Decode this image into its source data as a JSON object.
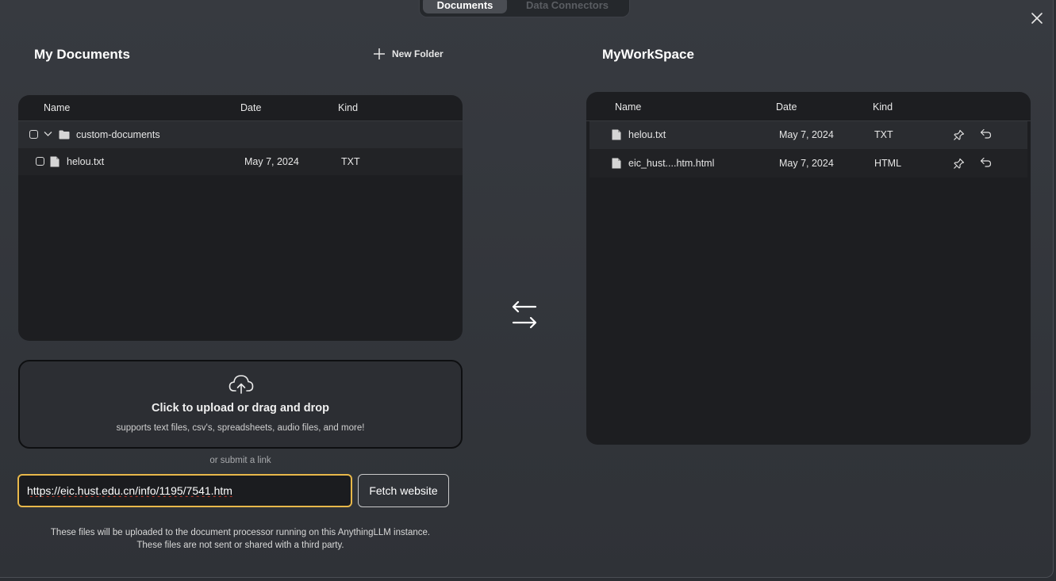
{
  "tabs": [
    {
      "label": "Documents",
      "active": true
    },
    {
      "label": "Data Connectors",
      "active": false
    }
  ],
  "my_documents": {
    "title": "My Documents",
    "new_folder_label": "New Folder",
    "columns": [
      "Name",
      "Date",
      "Kind"
    ],
    "folder": {
      "name": "custom-documents"
    },
    "files": [
      {
        "name": "helou.txt",
        "date": "May 7, 2024",
        "kind": "TXT"
      }
    ]
  },
  "upload": {
    "title": "Click to upload or drag and drop",
    "subtitle": "supports text files, csv's, spreadsheets, audio files, and more!",
    "or_link": "or submit a link",
    "url_value": "https://eic.hust.edu.cn/info/1195/7541.htm",
    "fetch_label": "Fetch website",
    "note_line1": "These files will be uploaded to the document processor running on this AnythingLLM instance.",
    "note_line2": "These files are not sent or shared with a third party."
  },
  "workspace": {
    "title": "MyWorkSpace",
    "columns": [
      "Name",
      "Date",
      "Kind"
    ],
    "files": [
      {
        "name": "helou.txt",
        "date": "May 7, 2024",
        "kind": "TXT"
      },
      {
        "name": "eic_hust....htm.html",
        "date": "May 7, 2024",
        "kind": "HTML"
      }
    ]
  },
  "colors": {
    "input_focus": "#e8b84a",
    "panel": "#1d1e21",
    "background": "#373a40"
  }
}
